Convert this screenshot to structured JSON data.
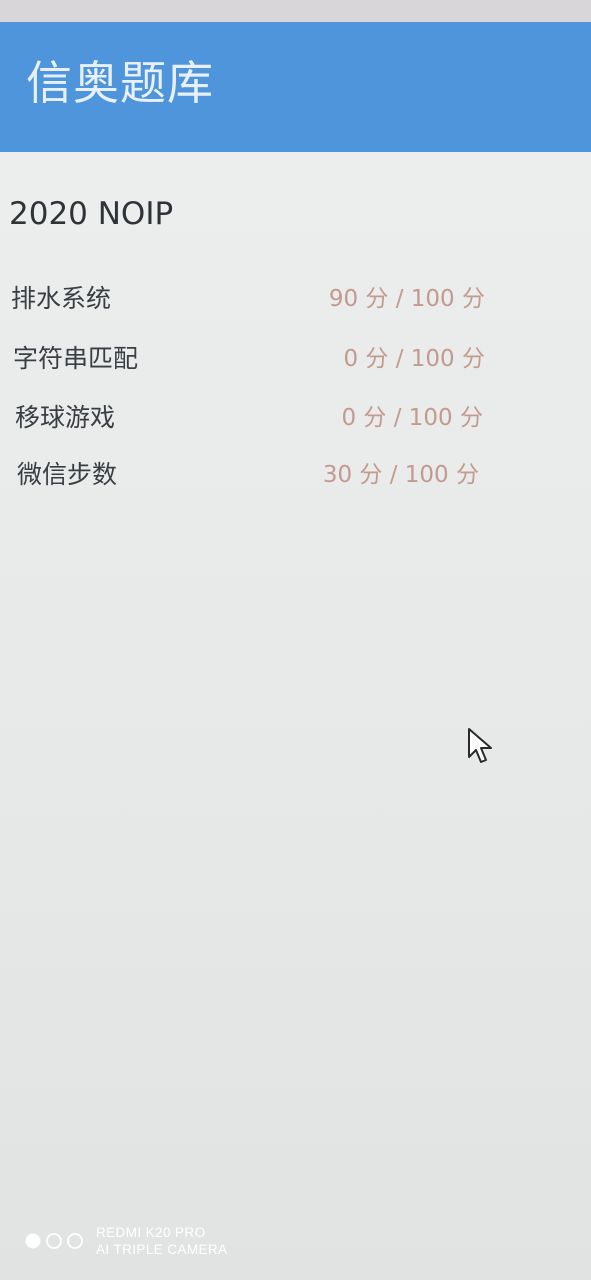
{
  "header": {
    "title": "信奥题库",
    "color": "#4f95dc"
  },
  "contest": {
    "title": "2020 NOIP"
  },
  "problems": [
    {
      "name": "排水系统",
      "score_text": "90 分 / 100 分",
      "score": 90,
      "max": 100
    },
    {
      "name": "字符串匹配",
      "score_text": "0 分 / 100 分",
      "score": 0,
      "max": 100
    },
    {
      "name": "移球游戏",
      "score_text": "0 分 / 100 分",
      "score": 0,
      "max": 100
    },
    {
      "name": "微信步数",
      "score_text": "30 分 / 100 分",
      "score": 30,
      "max": 100
    }
  ],
  "score_color": "#c39a8e",
  "watermark": {
    "line1": "REDMI K20 PRO",
    "line2": "AI TRIPLE CAMERA"
  }
}
